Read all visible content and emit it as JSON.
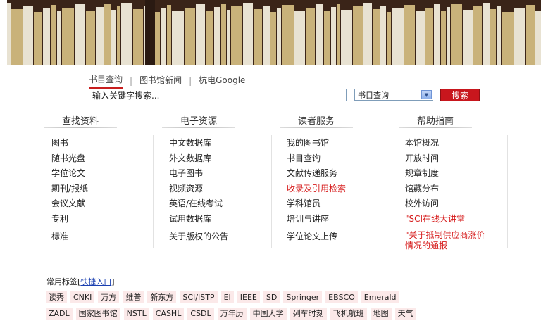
{
  "search": {
    "tabs": [
      "书目查询",
      "图书馆新闻",
      "杭电Google"
    ],
    "active_tab": 0,
    "input_value": "输入关键字搜索...",
    "select_value": "书目查询",
    "button_label": "搜索"
  },
  "columns": [
    {
      "heading": "查找资料",
      "items": [
        {
          "label": "图书"
        },
        {
          "label": "随书光盘"
        },
        {
          "label": "学位论文"
        },
        {
          "label": "期刊/报纸"
        },
        {
          "label": "会议文献"
        },
        {
          "label": "专利"
        },
        {
          "label": "标准"
        }
      ]
    },
    {
      "heading": "电子资源",
      "items": [
        {
          "label": "中文数据库"
        },
        {
          "label": "外文数据库"
        },
        {
          "label": "电子图书"
        },
        {
          "label": "视频资源"
        },
        {
          "label": "英语/在线考试"
        },
        {
          "label": "试用数据库"
        },
        {
          "label": "关于版权的公告"
        }
      ]
    },
    {
      "heading": "读者服务",
      "items": [
        {
          "label": "我的图书馆"
        },
        {
          "label": "书目查询"
        },
        {
          "label": "文献传递服务"
        },
        {
          "label": "收录及引用检索",
          "red": true
        },
        {
          "label": "学科馆员"
        },
        {
          "label": "培训与讲座"
        },
        {
          "label": "学位论文上传"
        }
      ]
    },
    {
      "heading": "帮助指南",
      "items": [
        {
          "label": "本馆概况"
        },
        {
          "label": "开放时间"
        },
        {
          "label": "规章制度"
        },
        {
          "label": "馆藏分布"
        },
        {
          "label": "校外访问"
        },
        {
          "label": "\"SCI在线大讲堂",
          "red": true
        },
        {
          "label": "\"关于抵制供应商涨价情况的通报",
          "red": true
        }
      ]
    }
  ],
  "tags": {
    "title": "常用标签",
    "quick_link": "快捷入口",
    "row1": [
      "读秀",
      "CNKI",
      "万方",
      "维普",
      "新东方",
      "SCI/ISTP",
      "EI",
      "IEEE",
      "SD",
      "Springer",
      "EBSCO",
      "Emerald"
    ],
    "row2": [
      "ZADL",
      "国家图书馆",
      "NSTL",
      "CASHL",
      "CSDL",
      "万年历",
      "中国大学",
      "列车时刻",
      "飞机航班",
      "地图",
      "天气"
    ]
  },
  "colors": {
    "accent": "#c8161d",
    "link_red": "#d61a1a",
    "tag_bg": "#fbe9e9",
    "link_blue": "#1a3fb0"
  }
}
